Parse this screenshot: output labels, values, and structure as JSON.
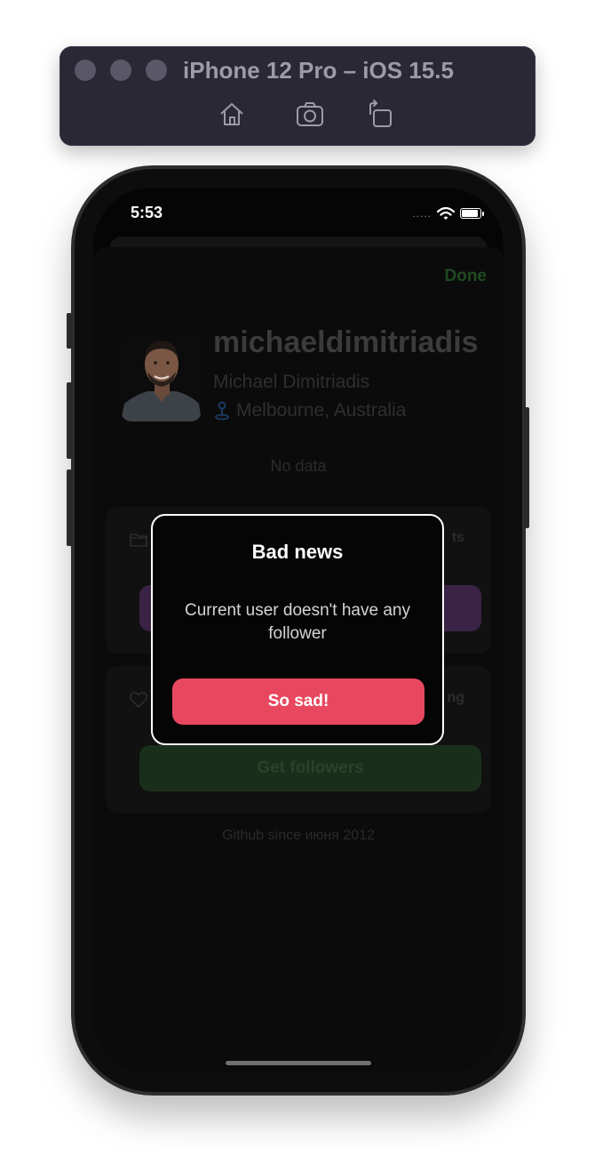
{
  "simulator": {
    "title": "iPhone 12 Pro – iOS 15.5",
    "icons": [
      "home-icon",
      "screenshot-icon",
      "rotate-icon"
    ]
  },
  "status_bar": {
    "time": "5:53",
    "signal": "....."
  },
  "profile": {
    "done_label": "Done",
    "username": "michaeldimitriadis",
    "full_name": "Michael Dimitriadis",
    "location": "Melbourne, Australia",
    "bio": "No data",
    "repos_card": {
      "icon": "folder-icon",
      "stat_fragment": "ts"
    },
    "followers_card": {
      "icon": "heart-icon",
      "stat_fragment": "ng",
      "button_label": "Get followers"
    },
    "since": "Github since июня 2012"
  },
  "alert": {
    "title": "Bad news",
    "message": "Current user doesn't have any follower",
    "button_label": "So sad!"
  },
  "colors": {
    "alert_button": "#e8485f",
    "repos_button": "#3a2346",
    "followers_button": "#1a2e1c",
    "done_text": "#1f4a22"
  }
}
